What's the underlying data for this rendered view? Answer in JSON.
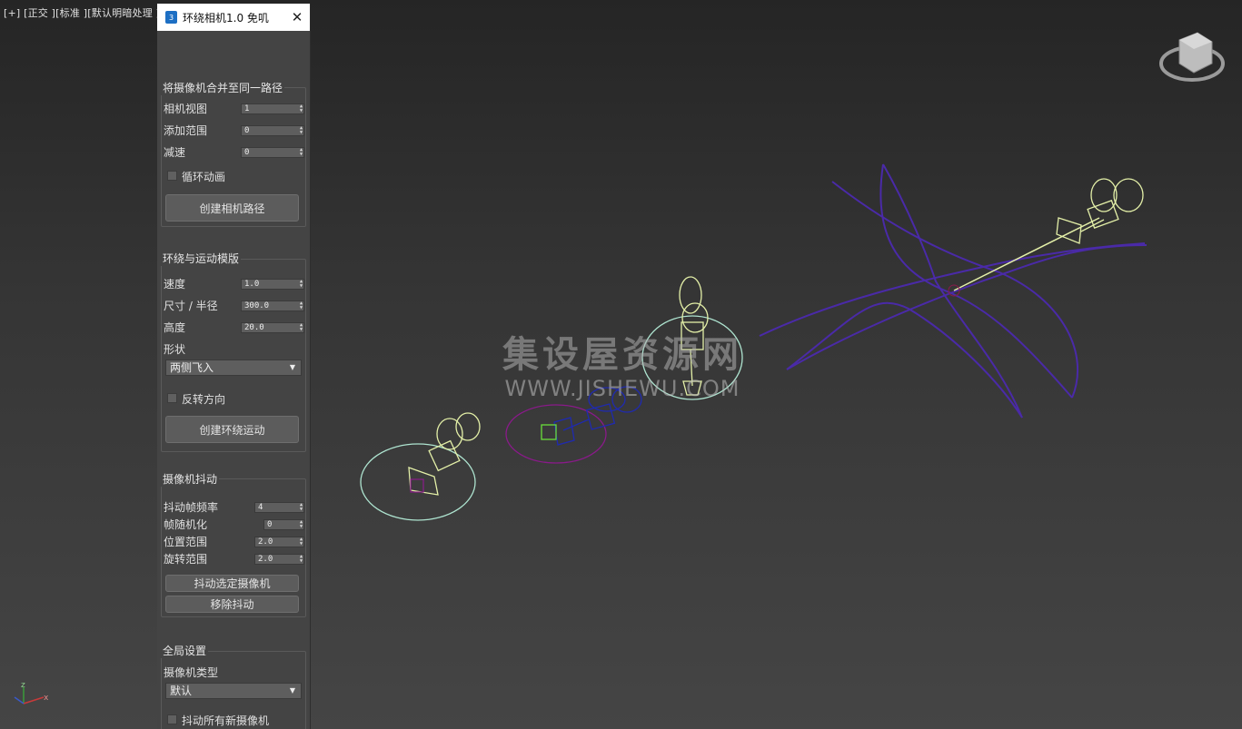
{
  "viewport": {
    "label": "[+] [正交 ][标准 ][默认明暗处理 ]",
    "watermark_cn": "集设屋资源网",
    "watermark_url": "WWW.JISHEWU.COM"
  },
  "window": {
    "icon_text": "3",
    "title": "环绕相机1.0 免叽",
    "close_label": "✕"
  },
  "merge_group": {
    "title": "将摄像机合并至同一路径",
    "camera_view_label": "相机视图",
    "camera_view_value": "1",
    "add_range_label": "添加范围",
    "add_range_value": "0",
    "decel_label": "减速",
    "decel_value": "0",
    "loop_label": "循环动画",
    "create_button": "创建相机路径"
  },
  "orbit_group": {
    "title": "环绕与运动模版",
    "speed_label": "速度",
    "speed_value": "1.0",
    "size_label": "尺寸 / 半径",
    "size_value": "300.0",
    "height_label": "高度",
    "height_value": "20.0",
    "shape_label": "形状",
    "shape_value": "两侧飞入",
    "reverse_label": "反转方向",
    "create_button": "创建环绕运动"
  },
  "shake_group": {
    "title": "摄像机抖动",
    "freq_label": "抖动帧频率",
    "freq_value": "4",
    "random_label": "帧随机化",
    "random_value": "0",
    "pos_label": "位置范围",
    "pos_value": "2.0",
    "rot_label": "旋转范围",
    "rot_value": "2.0",
    "shake_button": "抖动选定摄像机",
    "remove_button": "移除抖动"
  },
  "global_group": {
    "title": "全局设置",
    "cam_type_label": "摄像机类型",
    "cam_type_value": "默认",
    "shake_all_label": "抖动所有新摄像机"
  },
  "axis": {
    "z": "z",
    "x": "x"
  },
  "colors": {
    "camera_wire": "#e4f0a8",
    "path_purple": "#4a2aa8",
    "circle_cyan": "#aee4d0",
    "circle_purple": "#8a1a8a",
    "blue_wire": "#1f2ab0"
  }
}
